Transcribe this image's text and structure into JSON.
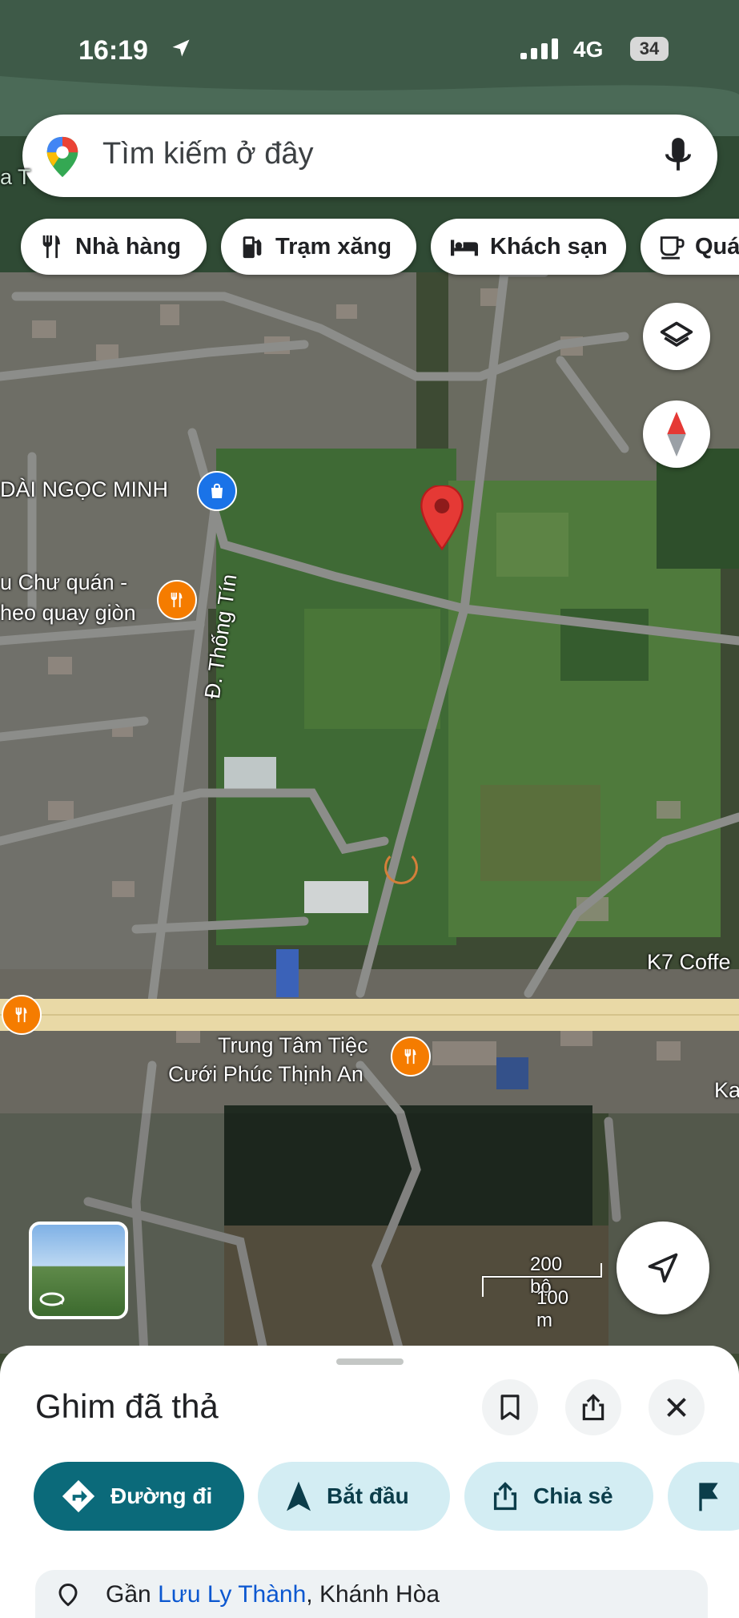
{
  "status_bar": {
    "time": "16:19",
    "network": "4G",
    "battery": "34"
  },
  "search": {
    "placeholder": "Tìm kiếm ở đây"
  },
  "chips": [
    {
      "label": "Nhà hàng",
      "icon": "fork-knife-icon"
    },
    {
      "label": "Trạm xăng",
      "icon": "gas-pump-icon"
    },
    {
      "label": "Khách sạn",
      "icon": "bed-icon"
    },
    {
      "label": "Quá",
      "icon": "coffee-cup-icon"
    }
  ],
  "map_labels": {
    "poi_1": "DÀI NGỌC MINH",
    "poi_2_line1": "u Chư quán -",
    "poi_2_line2": "heo quay giòn",
    "street": "Đ. Thống Tín",
    "poi_3": "K7 Coffe",
    "poi_4_line1": "Trung Tâm Tiệc",
    "poi_4_line2": "Cưới Phúc Thịnh An",
    "poi_5": "Ka",
    "edge_letter": "a T"
  },
  "scale": {
    "imperial": "200 bộ",
    "metric": "100 m"
  },
  "sheet": {
    "title": "Ghim đã thả",
    "actions": [
      {
        "label": "Đường đi",
        "icon": "directions-icon"
      },
      {
        "label": "Bắt đầu",
        "icon": "navigation-arrow-icon"
      },
      {
        "label": "Chia sẻ",
        "icon": "share-icon"
      },
      {
        "label": "",
        "icon": "flag-icon"
      }
    ],
    "address_prefix": "Gần",
    "address_link": "Lưu Ly Thành",
    "address_suffix": ", Khánh Hòa"
  },
  "colors": {
    "accent_teal": "#0b6a7a",
    "chip_light": "#d3edf3",
    "pin_red": "#e53935",
    "poi_orange": "#f57c00",
    "poi_blue": "#1a73e8"
  }
}
